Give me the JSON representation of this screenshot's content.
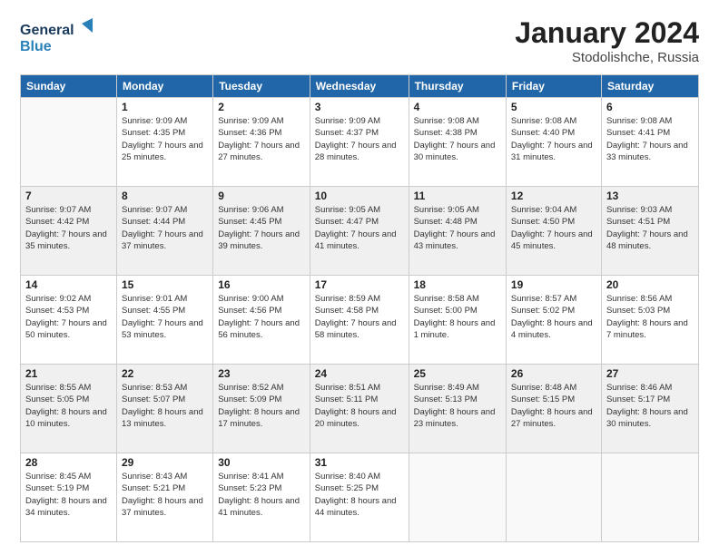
{
  "logo": {
    "line1": "General",
    "line2": "Blue"
  },
  "header": {
    "title": "January 2024",
    "location": "Stodolishche, Russia"
  },
  "days_of_week": [
    "Sunday",
    "Monday",
    "Tuesday",
    "Wednesday",
    "Thursday",
    "Friday",
    "Saturday"
  ],
  "weeks": [
    [
      {
        "day": "",
        "sunrise": "",
        "sunset": "",
        "daylight": ""
      },
      {
        "day": "1",
        "sunrise": "Sunrise: 9:09 AM",
        "sunset": "Sunset: 4:35 PM",
        "daylight": "Daylight: 7 hours and 25 minutes."
      },
      {
        "day": "2",
        "sunrise": "Sunrise: 9:09 AM",
        "sunset": "Sunset: 4:36 PM",
        "daylight": "Daylight: 7 hours and 27 minutes."
      },
      {
        "day": "3",
        "sunrise": "Sunrise: 9:09 AM",
        "sunset": "Sunset: 4:37 PM",
        "daylight": "Daylight: 7 hours and 28 minutes."
      },
      {
        "day": "4",
        "sunrise": "Sunrise: 9:08 AM",
        "sunset": "Sunset: 4:38 PM",
        "daylight": "Daylight: 7 hours and 30 minutes."
      },
      {
        "day": "5",
        "sunrise": "Sunrise: 9:08 AM",
        "sunset": "Sunset: 4:40 PM",
        "daylight": "Daylight: 7 hours and 31 minutes."
      },
      {
        "day": "6",
        "sunrise": "Sunrise: 9:08 AM",
        "sunset": "Sunset: 4:41 PM",
        "daylight": "Daylight: 7 hours and 33 minutes."
      }
    ],
    [
      {
        "day": "7",
        "sunrise": "Sunrise: 9:07 AM",
        "sunset": "Sunset: 4:42 PM",
        "daylight": "Daylight: 7 hours and 35 minutes."
      },
      {
        "day": "8",
        "sunrise": "Sunrise: 9:07 AM",
        "sunset": "Sunset: 4:44 PM",
        "daylight": "Daylight: 7 hours and 37 minutes."
      },
      {
        "day": "9",
        "sunrise": "Sunrise: 9:06 AM",
        "sunset": "Sunset: 4:45 PM",
        "daylight": "Daylight: 7 hours and 39 minutes."
      },
      {
        "day": "10",
        "sunrise": "Sunrise: 9:05 AM",
        "sunset": "Sunset: 4:47 PM",
        "daylight": "Daylight: 7 hours and 41 minutes."
      },
      {
        "day": "11",
        "sunrise": "Sunrise: 9:05 AM",
        "sunset": "Sunset: 4:48 PM",
        "daylight": "Daylight: 7 hours and 43 minutes."
      },
      {
        "day": "12",
        "sunrise": "Sunrise: 9:04 AM",
        "sunset": "Sunset: 4:50 PM",
        "daylight": "Daylight: 7 hours and 45 minutes."
      },
      {
        "day": "13",
        "sunrise": "Sunrise: 9:03 AM",
        "sunset": "Sunset: 4:51 PM",
        "daylight": "Daylight: 7 hours and 48 minutes."
      }
    ],
    [
      {
        "day": "14",
        "sunrise": "Sunrise: 9:02 AM",
        "sunset": "Sunset: 4:53 PM",
        "daylight": "Daylight: 7 hours and 50 minutes."
      },
      {
        "day": "15",
        "sunrise": "Sunrise: 9:01 AM",
        "sunset": "Sunset: 4:55 PM",
        "daylight": "Daylight: 7 hours and 53 minutes."
      },
      {
        "day": "16",
        "sunrise": "Sunrise: 9:00 AM",
        "sunset": "Sunset: 4:56 PM",
        "daylight": "Daylight: 7 hours and 56 minutes."
      },
      {
        "day": "17",
        "sunrise": "Sunrise: 8:59 AM",
        "sunset": "Sunset: 4:58 PM",
        "daylight": "Daylight: 7 hours and 58 minutes."
      },
      {
        "day": "18",
        "sunrise": "Sunrise: 8:58 AM",
        "sunset": "Sunset: 5:00 PM",
        "daylight": "Daylight: 8 hours and 1 minute."
      },
      {
        "day": "19",
        "sunrise": "Sunrise: 8:57 AM",
        "sunset": "Sunset: 5:02 PM",
        "daylight": "Daylight: 8 hours and 4 minutes."
      },
      {
        "day": "20",
        "sunrise": "Sunrise: 8:56 AM",
        "sunset": "Sunset: 5:03 PM",
        "daylight": "Daylight: 8 hours and 7 minutes."
      }
    ],
    [
      {
        "day": "21",
        "sunrise": "Sunrise: 8:55 AM",
        "sunset": "Sunset: 5:05 PM",
        "daylight": "Daylight: 8 hours and 10 minutes."
      },
      {
        "day": "22",
        "sunrise": "Sunrise: 8:53 AM",
        "sunset": "Sunset: 5:07 PM",
        "daylight": "Daylight: 8 hours and 13 minutes."
      },
      {
        "day": "23",
        "sunrise": "Sunrise: 8:52 AM",
        "sunset": "Sunset: 5:09 PM",
        "daylight": "Daylight: 8 hours and 17 minutes."
      },
      {
        "day": "24",
        "sunrise": "Sunrise: 8:51 AM",
        "sunset": "Sunset: 5:11 PM",
        "daylight": "Daylight: 8 hours and 20 minutes."
      },
      {
        "day": "25",
        "sunrise": "Sunrise: 8:49 AM",
        "sunset": "Sunset: 5:13 PM",
        "daylight": "Daylight: 8 hours and 23 minutes."
      },
      {
        "day": "26",
        "sunrise": "Sunrise: 8:48 AM",
        "sunset": "Sunset: 5:15 PM",
        "daylight": "Daylight: 8 hours and 27 minutes."
      },
      {
        "day": "27",
        "sunrise": "Sunrise: 8:46 AM",
        "sunset": "Sunset: 5:17 PM",
        "daylight": "Daylight: 8 hours and 30 minutes."
      }
    ],
    [
      {
        "day": "28",
        "sunrise": "Sunrise: 8:45 AM",
        "sunset": "Sunset: 5:19 PM",
        "daylight": "Daylight: 8 hours and 34 minutes."
      },
      {
        "day": "29",
        "sunrise": "Sunrise: 8:43 AM",
        "sunset": "Sunset: 5:21 PM",
        "daylight": "Daylight: 8 hours and 37 minutes."
      },
      {
        "day": "30",
        "sunrise": "Sunrise: 8:41 AM",
        "sunset": "Sunset: 5:23 PM",
        "daylight": "Daylight: 8 hours and 41 minutes."
      },
      {
        "day": "31",
        "sunrise": "Sunrise: 8:40 AM",
        "sunset": "Sunset: 5:25 PM",
        "daylight": "Daylight: 8 hours and 44 minutes."
      },
      {
        "day": "",
        "sunrise": "",
        "sunset": "",
        "daylight": ""
      },
      {
        "day": "",
        "sunrise": "",
        "sunset": "",
        "daylight": ""
      },
      {
        "day": "",
        "sunrise": "",
        "sunset": "",
        "daylight": ""
      }
    ]
  ]
}
